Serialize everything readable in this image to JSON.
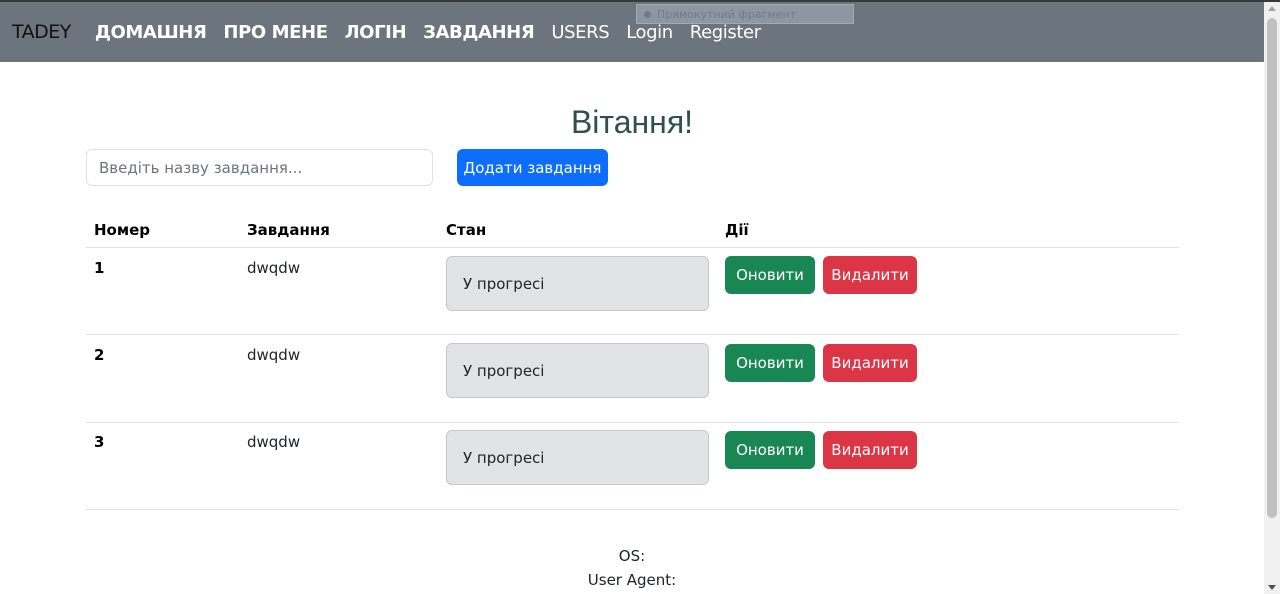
{
  "nav": {
    "brand": "TADEY",
    "items": [
      "ДОМАШНЯ",
      "ПРО МЕНЕ",
      "ЛОГІН",
      "ЗАВДАННЯ",
      "USERS",
      "Login",
      "Register"
    ]
  },
  "overlay": {
    "snip_label": "Прямокутний фрагмент"
  },
  "main": {
    "heading": "Вітання!",
    "input_placeholder": "Введіть назву завдання...",
    "add_button": "Додати завдання"
  },
  "table": {
    "headers": [
      "Номер",
      "Завдання",
      "Стан",
      "Дії"
    ],
    "rows": [
      {
        "num": "1",
        "task": "dwqdw",
        "status": "У прогресі",
        "update": "Оновити",
        "delete": "Видалити"
      },
      {
        "num": "2",
        "task": "dwqdw",
        "status": "У прогресі",
        "update": "Оновити",
        "delete": "Видалити"
      },
      {
        "num": "3",
        "task": "dwqdw",
        "status": "У прогресі",
        "update": "Оновити",
        "delete": "Видалити"
      }
    ]
  },
  "footer": {
    "os_label": "OS:",
    "ua_label": "User Agent:"
  },
  "colors": {
    "navbar": "#6c757d",
    "primary": "#0d6efd",
    "success": "#198754",
    "danger": "#dc3545",
    "heading": "#2f4f4f"
  }
}
